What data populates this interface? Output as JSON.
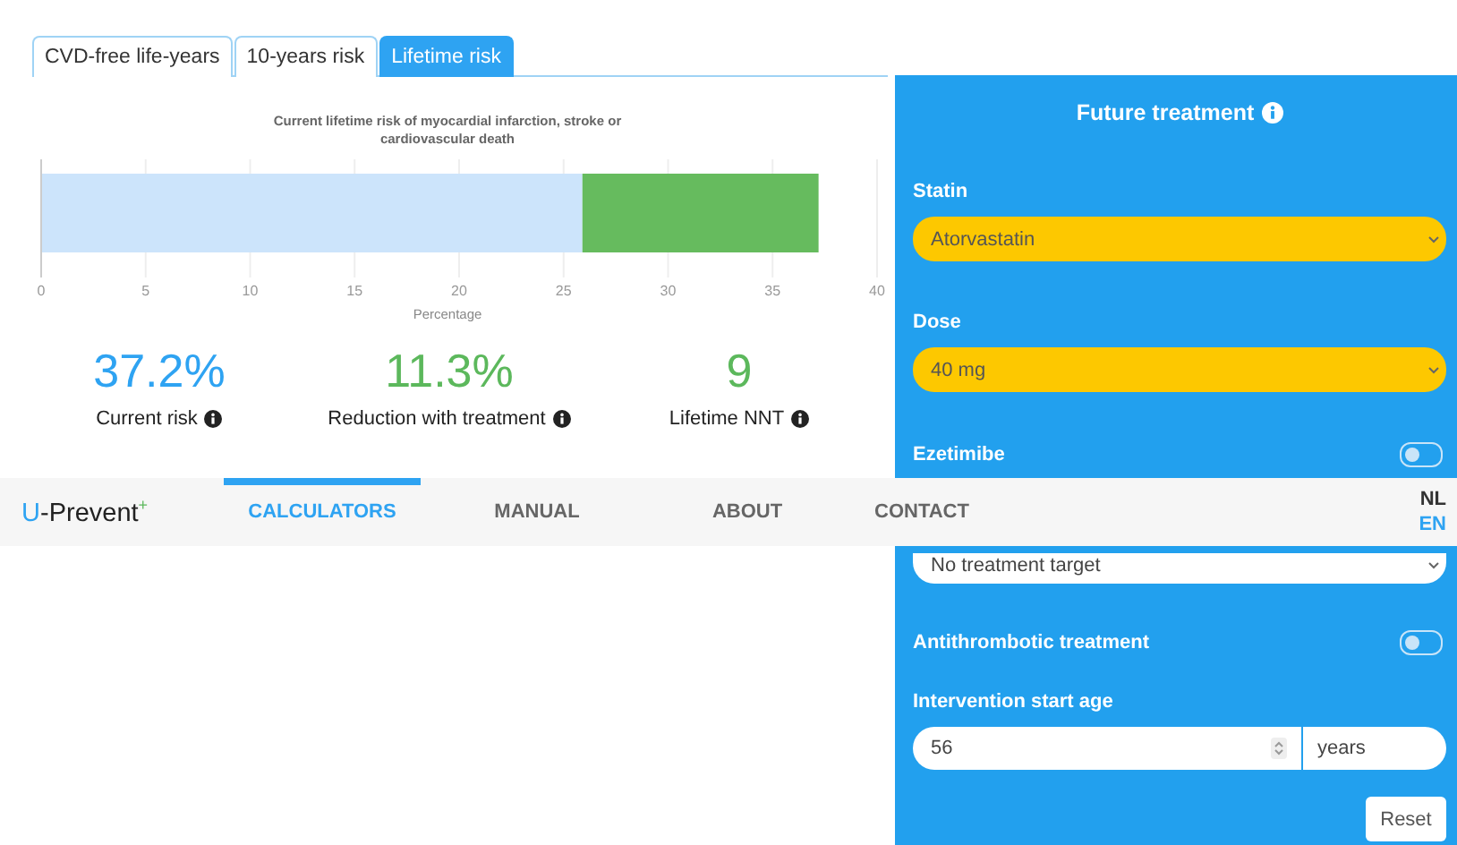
{
  "tabs": [
    {
      "label": "CVD-free life-years",
      "selected": false
    },
    {
      "label": "10-years risk",
      "selected": false
    },
    {
      "label": "Lifetime risk",
      "selected": true
    }
  ],
  "chart": {
    "chart_data": {
      "type": "bar",
      "orientation": "horizontal",
      "stacked": true,
      "title": "Current lifetime risk of myocardial infarction, stroke or cardiovascular death",
      "xlabel": "Percentage",
      "grid": true,
      "xlim": [
        0,
        40
      ],
      "xticks": [
        0,
        5,
        10,
        15,
        20,
        25,
        30,
        35,
        40
      ],
      "series": [
        {
          "color": "#cce4fb",
          "values": [
            25.9
          ]
        },
        {
          "color": "#66bb5e",
          "values": [
            11.3
          ]
        }
      ]
    }
  },
  "stats": [
    {
      "value": "37.2%",
      "label": "Current risk",
      "color": "#2ea3f2"
    },
    {
      "value": "11.3%",
      "label": "Reduction with treatment",
      "color": "#5cb85c"
    },
    {
      "value": "9",
      "label": "Lifetime NNT",
      "color": "#5cb85c"
    }
  ],
  "panel": {
    "title": "Future treatment",
    "fields": [
      {
        "kind": "select",
        "label": "Statin",
        "value": "Atorvastatin",
        "highlighted": true
      },
      {
        "kind": "select",
        "label": "Dose",
        "value": "40 mg",
        "highlighted": true
      },
      {
        "kind": "toggle",
        "label": "Ezetimibe",
        "on": false
      },
      {
        "kind": "select",
        "value": "No treatment target",
        "highlighted": false
      },
      {
        "kind": "toggle",
        "label": "Antithrombotic treatment",
        "on": false
      },
      {
        "kind": "number",
        "label": "Intervention start age",
        "value": "56",
        "unit": "years"
      }
    ],
    "reset": "Reset"
  },
  "nav": {
    "logo": {
      "initial": "U",
      "name": "-Prevent",
      "mark": "+"
    },
    "items": [
      {
        "label": "CALCULATORS",
        "selected": true
      },
      {
        "label": "MANUAL",
        "selected": false
      },
      {
        "label": "ABOUT",
        "selected": false
      },
      {
        "label": "CONTACT",
        "selected": false
      }
    ],
    "languages": [
      {
        "label": "NL",
        "selected": false
      },
      {
        "label": "EN",
        "selected": true
      }
    ]
  }
}
